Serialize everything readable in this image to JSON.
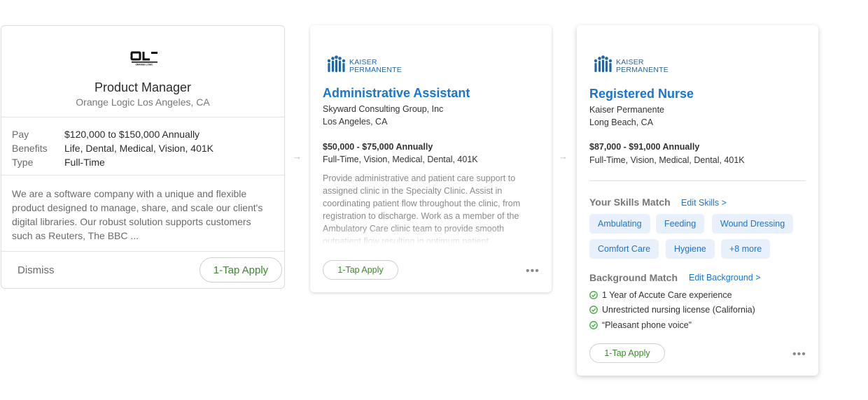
{
  "card1": {
    "company_logo_text": "OL ORANGE LOGIC",
    "title": "Product Manager",
    "subtitle": "Orange Logic Los Angeles, CA",
    "facts": [
      {
        "key": "Pay",
        "value": "$120,000 to $150,000 Annually"
      },
      {
        "key": "Benefits",
        "value": "Life, Dental, Medical, Vision, 401K"
      },
      {
        "key": "Type",
        "value": "Full-Time"
      }
    ],
    "description": "We are a software company with a unique and flexible product designed to manage, share, and scale our client's digital libraries. Our robust solution supports customers such as Reuters, The BBC ...",
    "dismiss_label": "Dismiss",
    "apply_label": "1-Tap Apply"
  },
  "arrows": [
    "→",
    "→"
  ],
  "card2": {
    "logo_line1": "KAISER",
    "logo_line2": "PERMANENTE",
    "title": "Administrative Assistant",
    "company": "Skyward Consulting Group, Inc",
    "location": "Los Angeles, CA",
    "salary": "$50,000 - $75,000 Annually",
    "benefits": "Full-Time, Vision, Medical, Dental, 401K",
    "description": "Provide administrative and patient care support to assigned clinic in the Specialty Clinic.    Assist in coordinating patient flow throughout the clinic, from registration to discharge.    Work as a member of the Ambulatory Care clinic team to provide smooth outpatient flow resulting in optimum patient",
    "apply_label": "1-Tap Apply",
    "more_label": "•••"
  },
  "card3": {
    "logo_line1": "KAISER",
    "logo_line2": "PERMANENTE",
    "title": "Registered Nurse",
    "company": "Kaiser Permanente",
    "location": "Long Beach, CA",
    "salary": "$87,000 - $91,000 Annually",
    "benefits": "Full-Time, Vision, Medical, Dental, 401K",
    "skills_title": "Your Skills Match",
    "skills_link": "Edit Skills >",
    "skills": [
      "Ambulating",
      "Feeding",
      "Wound Dressing",
      "Comfort Care",
      "Hygiene",
      "+8 more"
    ],
    "background_title": "Background Match",
    "background_link": "Edit Background >",
    "background_items": [
      "1 Year of Accute Care experience",
      "Unrestricted nursing license (California)",
      "“Pleasant phone voice”"
    ],
    "apply_label": "1-Tap Apply",
    "more_label": "•••"
  },
  "colors": {
    "link_blue": "#1a75d0",
    "apply_green": "#3a8a2a",
    "chip_bg": "#e8f1fb",
    "kaiser_blue": "#1f67a8",
    "check_green": "#3aa83a"
  }
}
